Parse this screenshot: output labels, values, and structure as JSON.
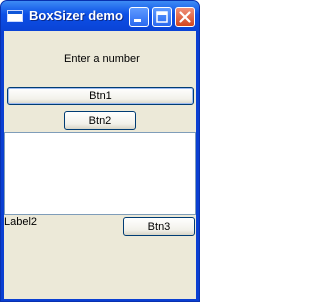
{
  "window": {
    "title": "BoxSizer demo"
  },
  "controls": {
    "prompt_label": "Enter a number",
    "btn1_label": "Btn1",
    "btn2_label": "Btn2",
    "label2": "Label2",
    "btn3_label": "Btn3"
  },
  "titlebar_buttons": [
    "minimize-icon",
    "maximize-icon",
    "close-icon"
  ]
}
